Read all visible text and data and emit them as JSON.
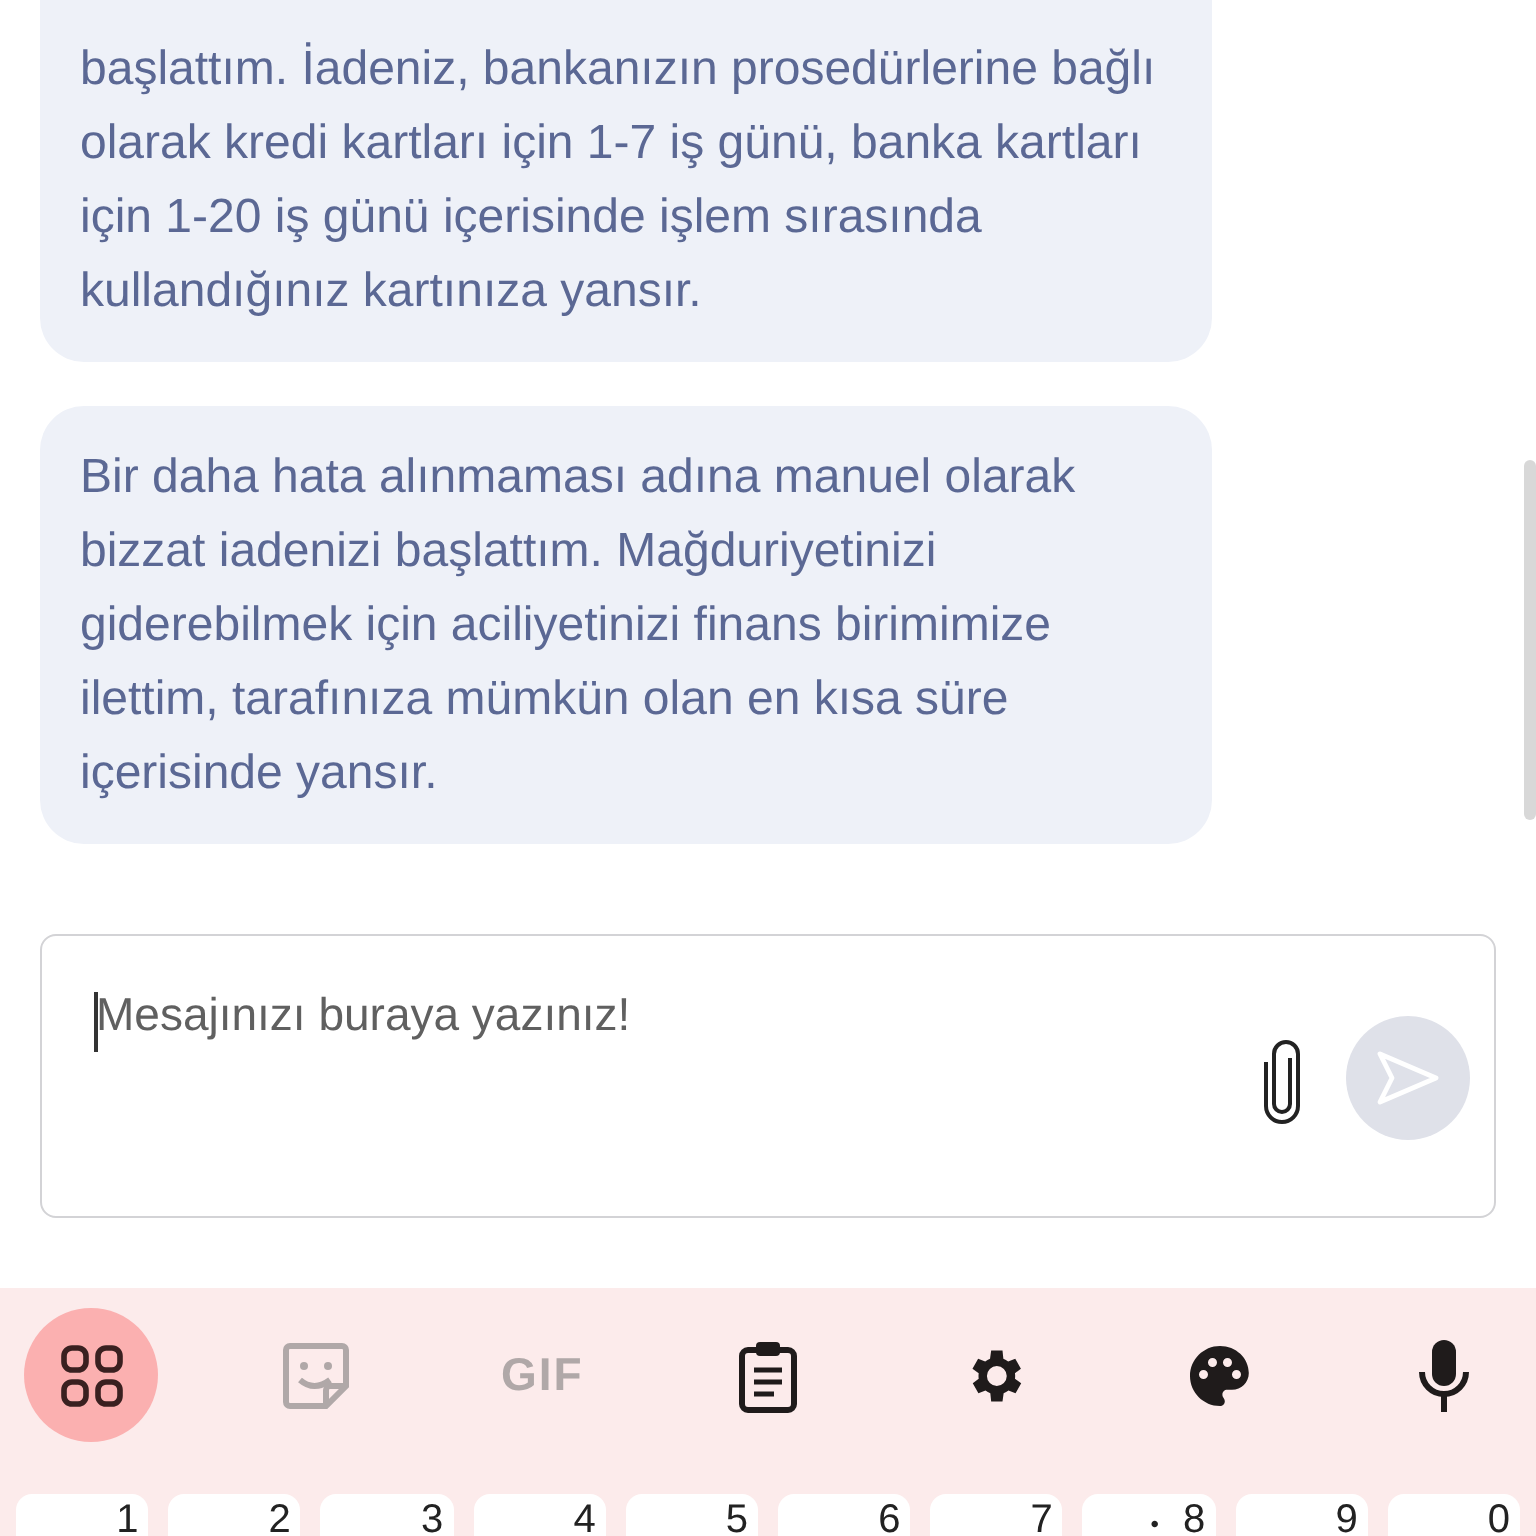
{
  "messages": [
    {
      "text": "başlattım. İadeniz, bankanızın prosedürlerine bağlı olarak kredi kartları için 1-7 iş günü, banka kartları için 1-20 iş günü içerisinde işlem sırasında kullandığınız kartınıza yansır.",
      "cut_top": true
    },
    {
      "text": "Bir daha hata alınmaması adına manuel olarak bizzat iadenizi başlattım. Mağduriyetinizi giderebilmek için aciliyetinizi finans birimimize ilettim, tarafınıza mümkün olan en kısa süre içerisinde yansır.",
      "cut_top": false
    }
  ],
  "composer": {
    "placeholder": "Mesajınızı buraya yazınız!",
    "send_disabled": true
  },
  "keyboard": {
    "toolbar": [
      {
        "kind": "icon",
        "selected": true,
        "disabled": false
      },
      {
        "kind": "icon",
        "selected": false,
        "disabled": true
      },
      {
        "kind": "text",
        "label": "GIF",
        "selected": false,
        "disabled": true
      },
      {
        "kind": "icon",
        "selected": false,
        "disabled": false
      },
      {
        "kind": "icon",
        "selected": false,
        "disabled": false
      },
      {
        "kind": "icon",
        "selected": false,
        "disabled": false
      },
      {
        "kind": "icon",
        "selected": false,
        "disabled": false
      }
    ],
    "keys": [
      {
        "label": "1"
      },
      {
        "label": "2"
      },
      {
        "label": "3"
      },
      {
        "label": "4"
      },
      {
        "label": "5"
      },
      {
        "label": "6"
      },
      {
        "label": "7"
      },
      {
        "label": "8",
        "hint": "•"
      },
      {
        "label": "9"
      },
      {
        "label": "0"
      }
    ]
  }
}
